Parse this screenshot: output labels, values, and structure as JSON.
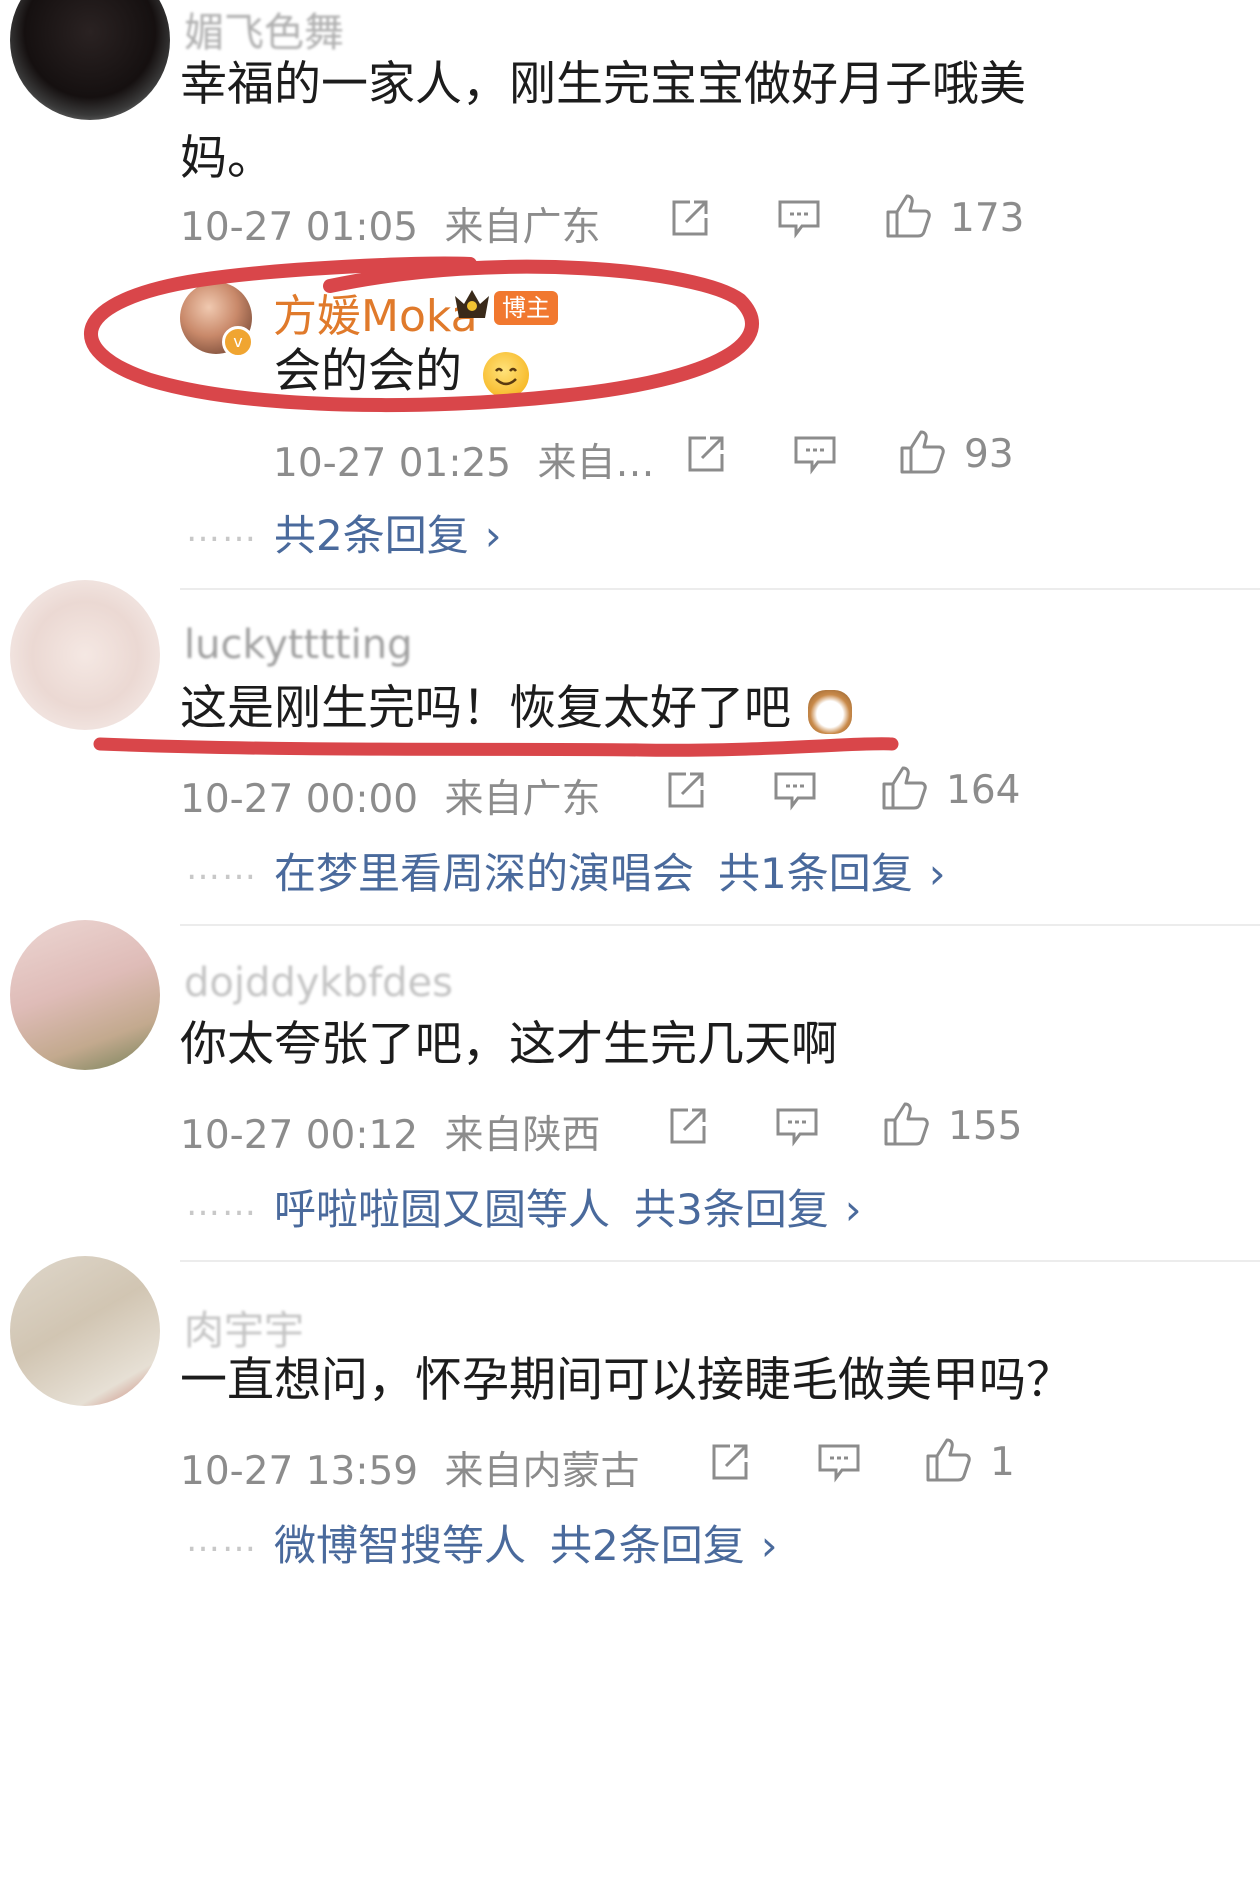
{
  "comments": [
    {
      "username": "媚飞色舞",
      "text": "幸福的一家人，刚生完宝宝做好月子哦美妈。",
      "time": "10-27 01:05",
      "location": "来自广东",
      "likes": "173",
      "reply": {
        "username": "方媛Moka",
        "badge": "博主",
        "text": "会的会的",
        "time": "10-27 01:25",
        "location": "来自…",
        "likes": "93"
      },
      "more_replies": "共2条回复",
      "more_prefix": ""
    },
    {
      "username": "luckytttting",
      "text": "这是刚生完吗！恢复太好了吧",
      "time": "10-27 00:00",
      "location": "来自广东",
      "likes": "164",
      "more_prefix": "在梦里看周深的演唱会",
      "more_replies": "共1条回复"
    },
    {
      "username": "dojddykbfdes",
      "text": "你太夸张了吧，这才生完几天啊",
      "time": "10-27 00:12",
      "location": "来自陕西",
      "likes": "155",
      "more_prefix": "呼啦啦圆又圆等人",
      "more_replies": "共3条回复"
    },
    {
      "username": "肉宇宇",
      "text": "一直想问，怀孕期间可以接睫毛做美甲吗？",
      "time": "10-27 13:59",
      "location": "来自内蒙古",
      "likes": "1",
      "more_prefix": "微博智搜等人",
      "more_replies": "共2条回复"
    }
  ],
  "dots": "……",
  "chevron": "›",
  "colors": {
    "link": "#4a6a9c",
    "meta": "#8c8c8c",
    "host": "#e07a2b",
    "annotation": "#d9464a"
  },
  "icons": [
    "share-icon",
    "comment-icon",
    "like-icon",
    "chevron-right-icon",
    "crown-icon",
    "verified-icon",
    "smile-emoji",
    "cat-emoji"
  ]
}
